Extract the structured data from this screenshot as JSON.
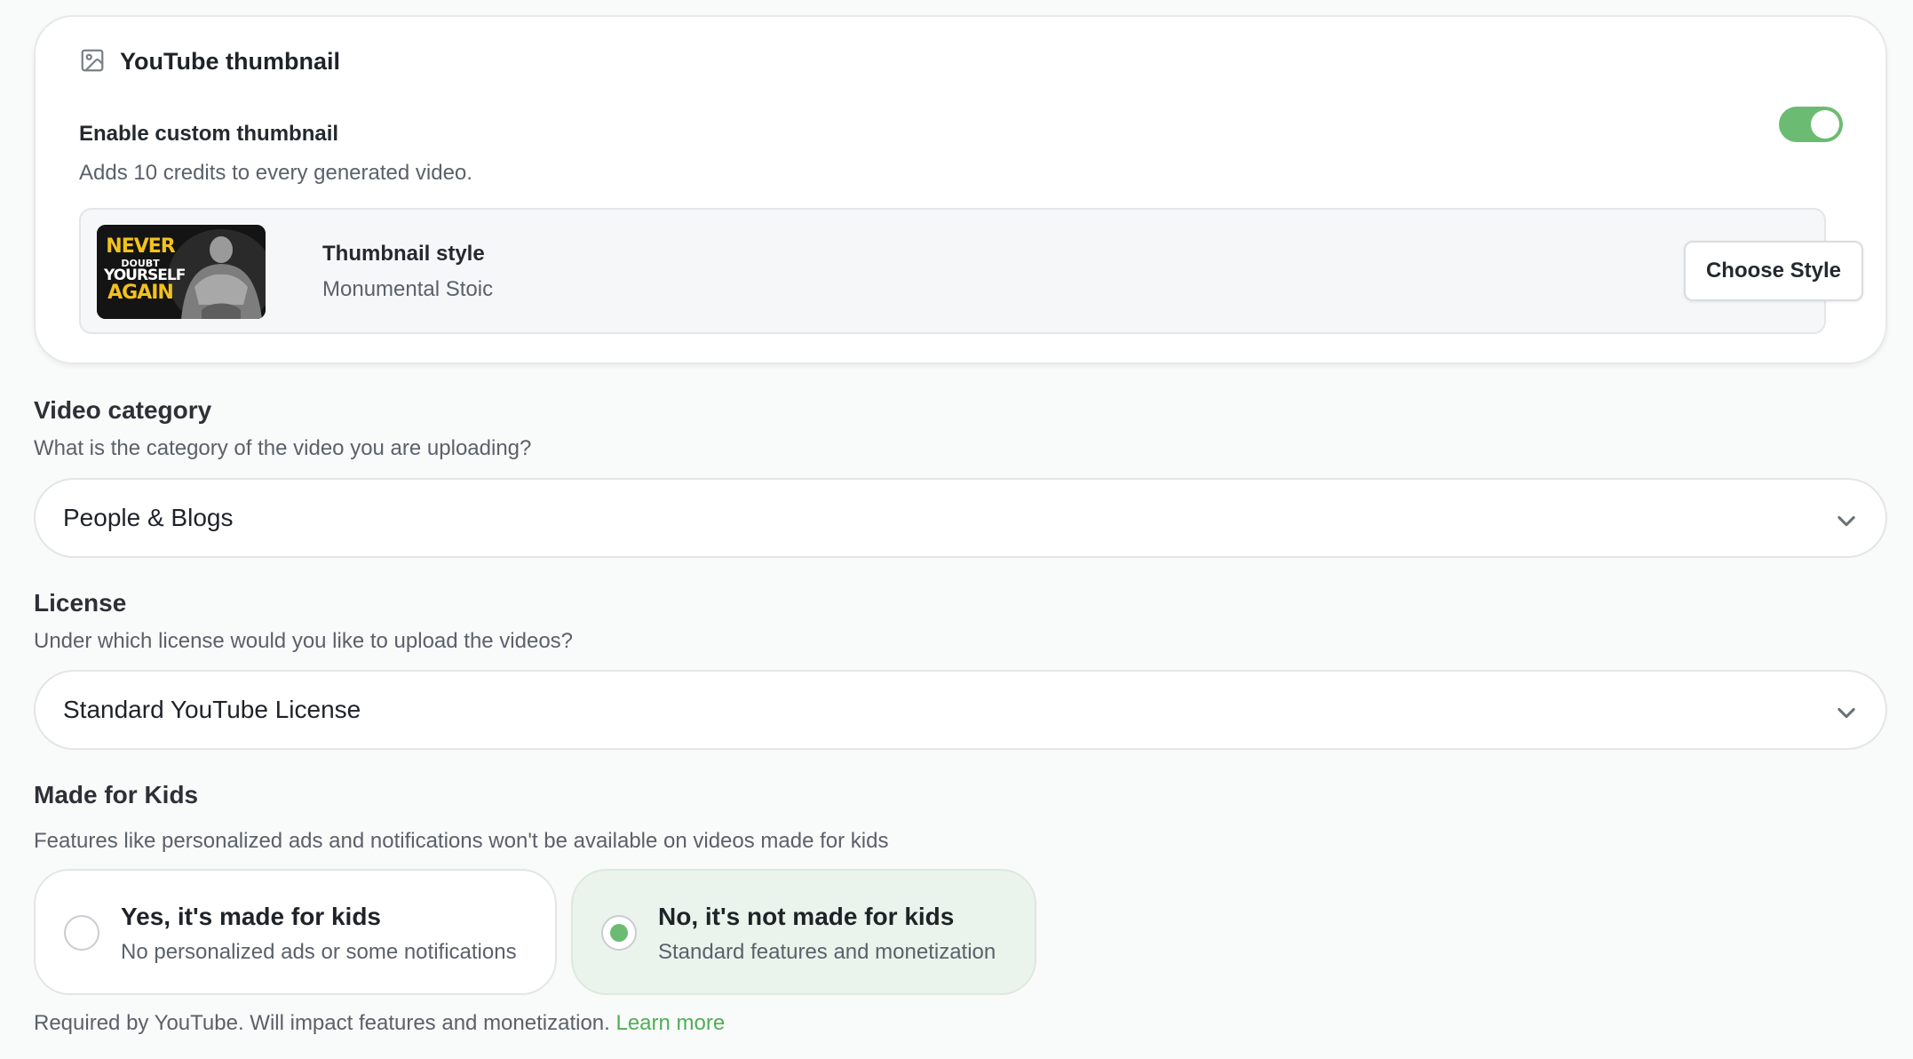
{
  "thumbnail_card": {
    "title": "YouTube thumbnail",
    "enable_label": "Enable custom thumbnail",
    "enable_desc": "Adds 10 credits to every generated video.",
    "enabled": true,
    "style_label": "Thumbnail style",
    "style_value": "Monumental Stoic",
    "choose_button": "Choose Style",
    "preview": {
      "line1": "NEVER",
      "line2": "DOUBT",
      "line3": "YOURSELF",
      "line4": "AGAIN"
    }
  },
  "category": {
    "title": "Video category",
    "desc": "What is the category of the video you are uploading?",
    "value": "People & Blogs"
  },
  "license": {
    "title": "License",
    "desc": "Under which license would you like to upload the videos?",
    "value": "Standard YouTube License"
  },
  "kids": {
    "title": "Made for Kids",
    "desc": "Features like personalized ads and notifications won't be available on videos made for kids",
    "options": [
      {
        "title": "Yes, it's made for kids",
        "sub": "No personalized ads or some notifications",
        "selected": false
      },
      {
        "title": "No, it's not made for kids",
        "sub": "Standard features and monetization",
        "selected": true
      }
    ],
    "footnote": "Required by YouTube. Will impact features and monetization.",
    "learn_more": "Learn more"
  },
  "colors": {
    "accent": "#6cbb72",
    "link": "#4fae57",
    "selected_bg": "#eaf4ec"
  }
}
